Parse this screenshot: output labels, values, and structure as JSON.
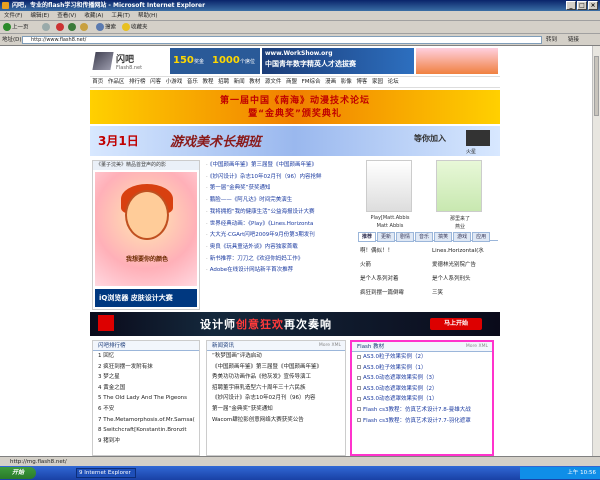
{
  "window": {
    "title": "闪吧，专业的flash学习和传播网站 - Microsoft Internet Explorer"
  },
  "menu": [
    "文件(F)",
    "编辑(E)",
    "查看(V)",
    "收藏(A)",
    "工具(T)",
    "帮助(H)"
  ],
  "toolbar": {
    "back": "上一页",
    "search": "搜索",
    "favorites": "收藏夹"
  },
  "address": {
    "label": "地址(D)",
    "value": "http://www.flash8.net/",
    "go": "转到",
    "links": "链接"
  },
  "status": {
    "text": "http://mg.flash8.net/"
  },
  "taskbar": {
    "start": "开始",
    "task": "9 Internet Explorer",
    "clock": "上午 10:56"
  },
  "site": {
    "logo_main": "闪吧",
    "logo_sub": "Flash8.net",
    "ad1": {
      "a": "150",
      "b": "奖金",
      "c": "1000",
      "d": "个席位"
    },
    "ad2": {
      "url": "www.WorkShow.org",
      "text": "中国青年数字精英人才选拔赛"
    },
    "nav": [
      "首页",
      "作品区",
      "排行榜",
      "闪客",
      "小游戏",
      "音乐",
      "教程",
      "招聘",
      "新闻",
      "教材",
      "源文件",
      "商盟",
      "FM综合",
      "漫画",
      "影像",
      "博客",
      "家园",
      "论坛"
    ],
    "banner1": {
      "line1": "第一届中国《南海》动漫技术论坛",
      "line2": "暨“金典奖”颁奖典礼"
    },
    "banner2": {
      "date": "3月1日",
      "title": "游戏美术长期班",
      "join": "等你加入",
      "brand": "火星"
    },
    "leftad": {
      "caption": "《董子沈美》精品首登声的的影",
      "art_title": "我想要你的颜色",
      "footer": "iQ浏览器 皮肤设计大赛"
    },
    "midlist": [
      "《中国颜画年鉴》第三届暨《中国颜画年鉴》",
      "《妙闪设计》杂志10年02月刊（96）内容抢鲜",
      "第一届“金典奖”获奖通知",
      "鹏脸——《阿凡达》时间完美演生",
      "我将拥抱“我的健康生活”公益海报设计大赛",
      "世界经典动画：《Play》《Lines.Horizonta",
      "大大光·CGArt闪吧2009年9月份第3期发刊",
      "奥良《玩具童话外谈》内容独家首载",
      "新书推荐：刀刀之《欢迎你妈妈工作》",
      "Adobe在线设计网站新平首次推荐"
    ],
    "thumbs": [
      {
        "title": "Play[Matt.Abbis",
        "author": "Matt Abbis"
      },
      {
        "title": "那里来了",
        "author": "燕业"
      }
    ],
    "rec": {
      "tabs": [
        "推荐",
        "更新",
        "剧情",
        "音乐",
        "搞笑",
        "游戏",
        "应用"
      ],
      "left": [
        "啊！偶似！！",
        "火箭",
        "是个人系列对着",
        "疯狂到摆一篇倒霉"
      ],
      "right": [
        "Lines.Horizontal(水",
        "爱德林光别院广告",
        "是个人系列刑头",
        "三笑"
      ]
    },
    "banner3": {
      "pre": "设计师",
      "hi": "创意狂欢",
      "post": "再次奏响",
      "btn": "马上开始"
    },
    "rank": {
      "title": "闪吧排行榜",
      "items": [
        "1 回忆",
        "2 疯狂到摆一发附有抹",
        "3 梦之星",
        "4 黄金之国",
        "5 The Old Lady And The Pigeons",
        "6 不安",
        "7 The.Metamorphosis.of.Mr.Samsa(",
        "8 Switchcraft[Konstantin.Bronzit",
        "9 猪到冲"
      ]
    },
    "news": {
      "title": "新闻资讯",
      "more": "More",
      "rss": "XML",
      "items": [
        "“秋梦国画”评选启动",
        "《中国颜画年鉴》第三届暨《中国颜画年鉴》",
        "秀美功功功画作品《他灰发》宣传导演工",
        "招聘董宇麻乳造型六十周年三十六民族",
        "《妙闪设计》杂志10年02月刊（96）内容",
        "第一届“金典奖”获奖通知",
        "Wacom肆拉影创意网络大赛获奖公告"
      ]
    },
    "flash": {
      "title": "Flash 教材",
      "more": "More",
      "rss": "XML",
      "items": [
        "AS3.0粒子效果实例（2）",
        "AS3.0粒子效果实例（1）",
        "AS3.0动态遮罩效果实例（3）",
        "AS3.0动态遮罩效果实例（2）",
        "AS3.0动态遮罩效果实例（1）",
        "Flash cs3教程：仿真艺术设计7.8-曼雄大战",
        "Flash cs3教程：仿真艺术设计7.7-羽化遮罩"
      ]
    }
  }
}
